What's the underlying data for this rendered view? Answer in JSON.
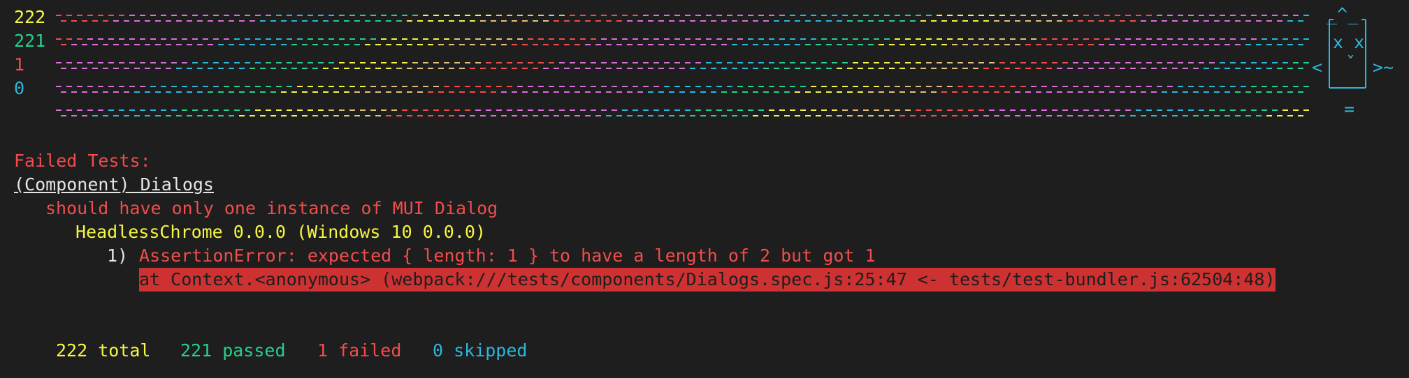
{
  "reporter": {
    "counts": {
      "total": "222",
      "passed": "221",
      "failed": "1",
      "skipped": "0"
    },
    "cat": {
      "ears": "_^_",
      "eyes": "x x",
      "mouth": "ˇ",
      "base": "=",
      "tail": ">~",
      "paw": "<"
    },
    "colors": {
      "rainbow": [
        "#f14c4c",
        "#e06cdf",
        "#d670d6",
        "#29b8db",
        "#23d18b",
        "#f5f543",
        "#e5c07b"
      ]
    }
  },
  "failures": {
    "header": "Failed Tests:",
    "suite": "(Component) Dialogs",
    "test": "should have only one instance of MUI Dialog",
    "browser": "HeadlessChrome 0.0.0 (Windows 10 0.0.0)",
    "error_index": "1)",
    "error_message": "AssertionError: expected { length: 1 } to have a length of 2 but got 1",
    "error_location": "at Context.<anonymous> (webpack:///tests/components/Dialogs.spec.js:25:47 <- tests/test-bundler.js:62504:48)"
  },
  "summary": {
    "total": "222 total",
    "passed": "221 passed",
    "failed": "1 failed",
    "skipped": "0 skipped"
  }
}
